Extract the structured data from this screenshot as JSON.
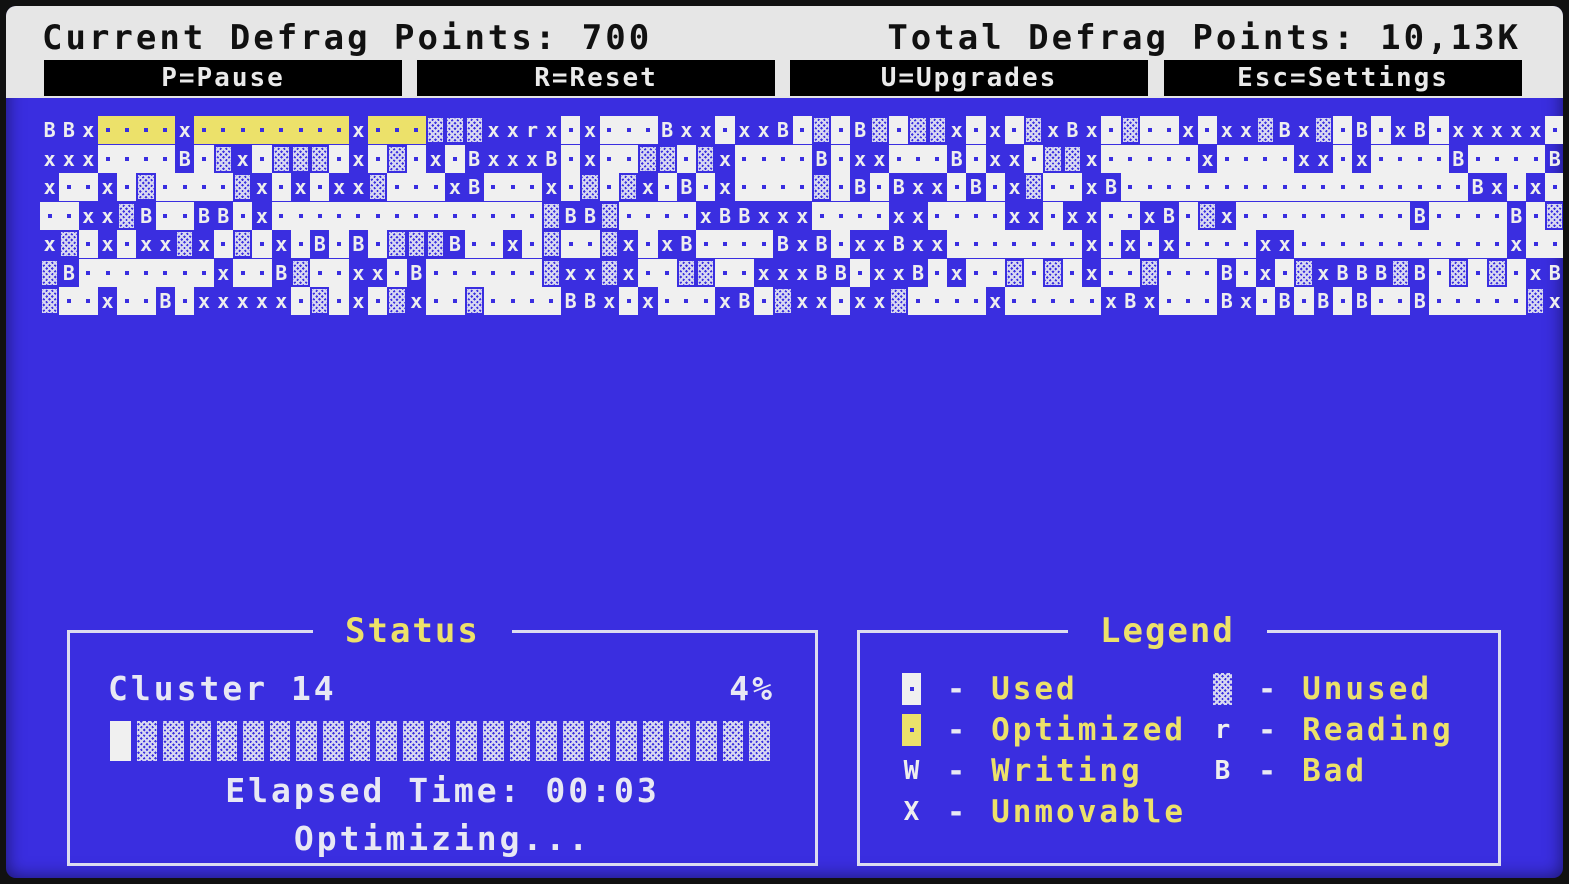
{
  "header": {
    "current_points": "Current Defrag Points: 700",
    "total_points": "Total Defrag Points: 10,13K"
  },
  "controls": [
    {
      "label": "P=Pause"
    },
    {
      "label": "R=Reset"
    },
    {
      "label": "U=Upgrades"
    },
    {
      "label": "Esc=Settings"
    }
  ],
  "disk_map": {
    "rows": [
      "BBXooooXooooooooXooo___XXrXoXoooBXXoXXBo_oB_o__XoXo_XBXo_ooXoXX_BX_oBoXBoXXXXXooo_BX",
      "XXXooooBo_Xo___oXo_oXoBXXXBoXoo__o_XooooBoXXoooBoXXo__XoooooXooooXXoXooooBooooB_oo",
      "XooXo_oooo_XoXoXX_oooXBoooXo_o_XoBoXoooo_oBoBXXoBoX_ooXBooooooooooooooooooBXoXoX",
      "ooXX_BooBBoXoooooooooooooo_BB_ooooXBBXXXooooXXooooXXoXXooXBo_XoooooooooBooooBo_Bo_o",
      "X_oXoXX_Xo_oXoBoBo___BooXo_oo_XoXBooooBXBoXXBXXoooooooXoXoXooooXXoooooooooooXoooB_oX",
      "_BoooooooXooB_ooXXoBoooooo_XX_Xoo__ooXXXBBoXXBoXoo_o_oXoo_oooBoXo_XBBB_Bo_o_oXBooo_oo",
      "_ooXooBoXXXXXo_oXo_Xoo_ooooBBXoXoooXBo_XXoXX_ooooXoooooXBXoooBXoBoBoBooBooooo_XBooX"
    ]
  },
  "status": {
    "title": "Status",
    "cluster": "Cluster 14",
    "percent": "4%",
    "progress": 0.04,
    "elapsed": "Elapsed Time: 00:03",
    "state": "Optimizing..."
  },
  "legend": {
    "title": "Legend",
    "items": [
      {
        "symbol": "",
        "type": "used",
        "label": "Used"
      },
      {
        "symbol": "",
        "type": "unused",
        "label": "Unused"
      },
      {
        "symbol": "",
        "type": "opt",
        "label": "Optimized"
      },
      {
        "symbol": "r",
        "type": "read",
        "label": "Reading"
      },
      {
        "symbol": "W",
        "type": "write",
        "label": "Writing"
      },
      {
        "symbol": "B",
        "type": "bad",
        "label": "Bad"
      },
      {
        "symbol": "X",
        "type": "unm",
        "label": "Unmovable"
      }
    ]
  },
  "colors": {
    "background": "#3a2ee0",
    "optimized": "#ece16a",
    "used": "#f0f0f0",
    "titles": "#ece16a"
  }
}
